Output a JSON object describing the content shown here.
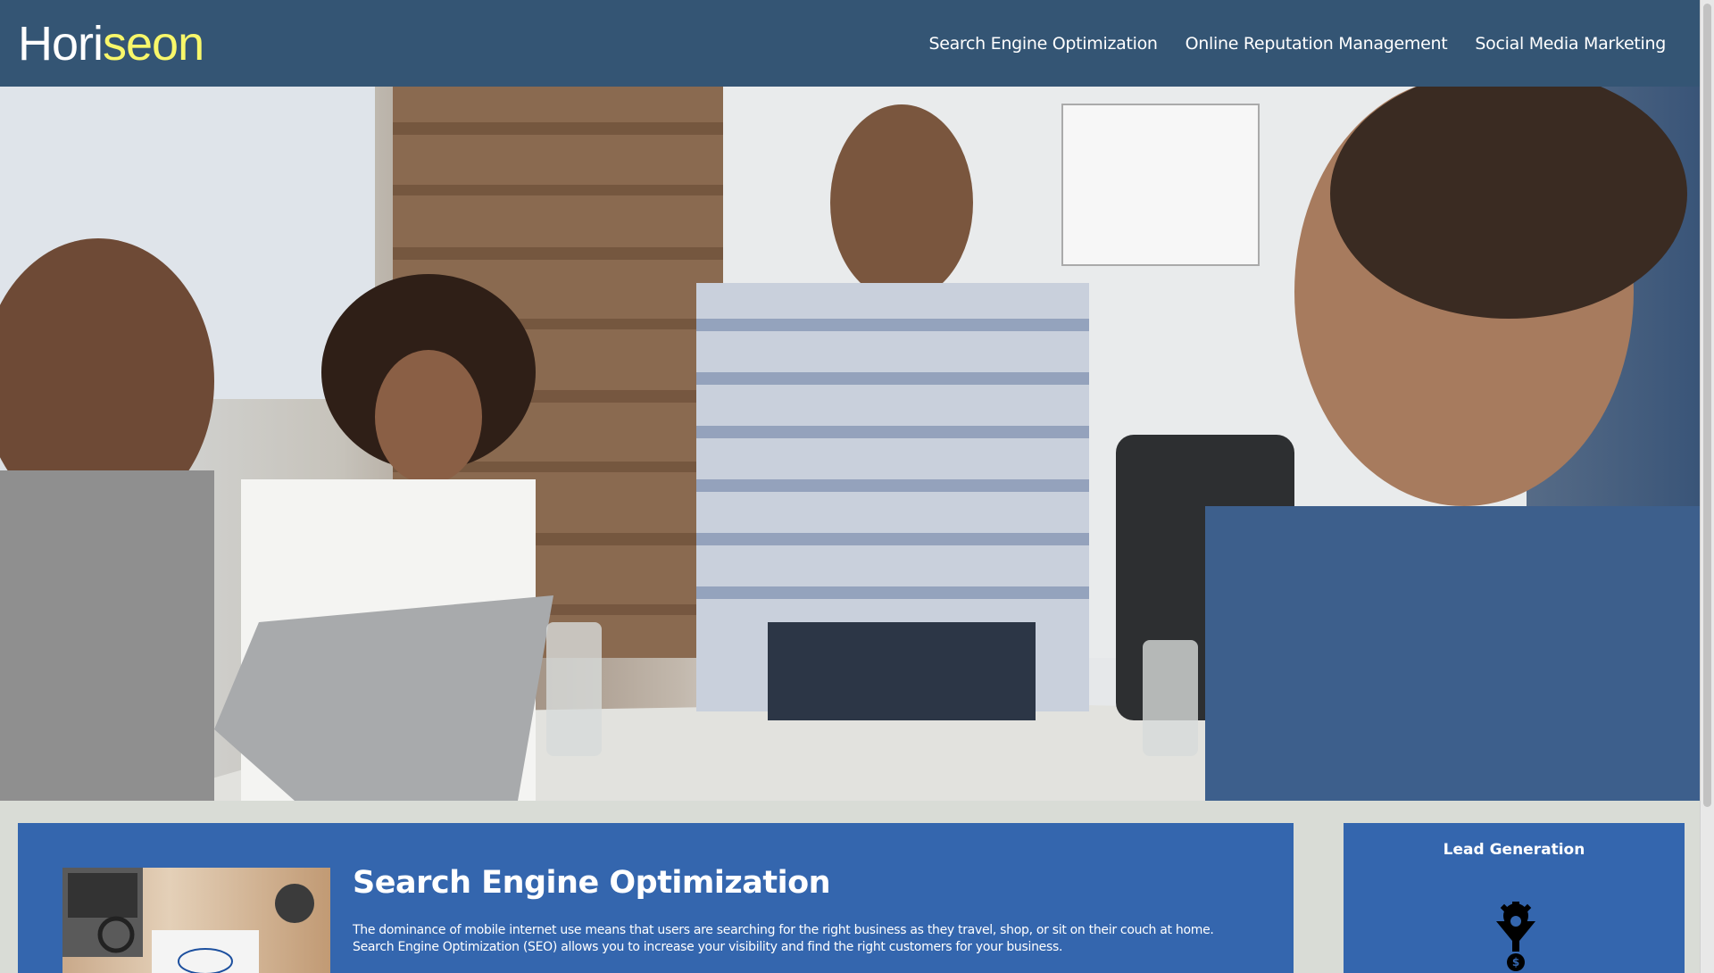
{
  "header": {
    "logo_part1": "Hori",
    "logo_part2": "seon",
    "nav": [
      {
        "label": "Search Engine Optimization"
      },
      {
        "label": "Online Reputation Management"
      },
      {
        "label": "Social Media Marketing"
      }
    ]
  },
  "hero": {
    "icon": "hero-photo-team-meeting"
  },
  "content": {
    "title": "Search Engine Optimization",
    "body": "The dominance of mobile internet use means that users are searching for the right business as they travel, shop, or sit on their couch at home. Search Engine Optimization (SEO) allows you to increase your visibility and find the right customers for your business."
  },
  "aside": {
    "title": "Lead Generation",
    "icon": "lead-generation-funnel-icon"
  },
  "colors": {
    "header_bg": "#345574",
    "accent": "#f8f76a",
    "card_bg": "#3466ae",
    "page_bg": "#d9dcd6"
  }
}
